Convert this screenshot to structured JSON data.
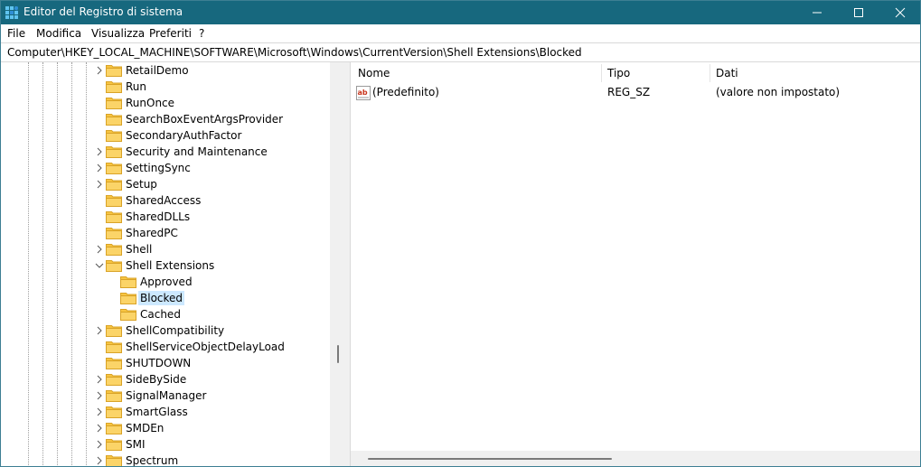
{
  "window": {
    "title": "Editor del Registro di sistema",
    "app_icon": "registry-editor-icon",
    "buttons": [
      "minimize-icon",
      "maximize-icon",
      "close-icon"
    ],
    "titlebar_color": "#17687e"
  },
  "menu": {
    "items": [
      "File",
      "Modifica",
      "Visualizza",
      "Preferiti",
      "?"
    ]
  },
  "address": {
    "path": "Computer\\HKEY_LOCAL_MACHINE\\SOFTWARE\\Microsoft\\Windows\\CurrentVersion\\Shell Extensions\\Blocked"
  },
  "tree": {
    "items": [
      {
        "label": "RetailDemo",
        "expandable": true,
        "expanded": false,
        "level": 0
      },
      {
        "label": "Run",
        "expandable": false,
        "expanded": false,
        "level": 0
      },
      {
        "label": "RunOnce",
        "expandable": false,
        "expanded": false,
        "level": 0
      },
      {
        "label": "SearchBoxEventArgsProvider",
        "expandable": false,
        "expanded": false,
        "level": 0
      },
      {
        "label": "SecondaryAuthFactor",
        "expandable": false,
        "expanded": false,
        "level": 0
      },
      {
        "label": "Security and Maintenance",
        "expandable": true,
        "expanded": false,
        "level": 0
      },
      {
        "label": "SettingSync",
        "expandable": true,
        "expanded": false,
        "level": 0
      },
      {
        "label": "Setup",
        "expandable": true,
        "expanded": false,
        "level": 0
      },
      {
        "label": "SharedAccess",
        "expandable": false,
        "expanded": false,
        "level": 0
      },
      {
        "label": "SharedDLLs",
        "expandable": false,
        "expanded": false,
        "level": 0
      },
      {
        "label": "SharedPC",
        "expandable": false,
        "expanded": false,
        "level": 0
      },
      {
        "label": "Shell",
        "expandable": true,
        "expanded": false,
        "level": 0
      },
      {
        "label": "Shell Extensions",
        "expandable": true,
        "expanded": true,
        "level": 0
      },
      {
        "label": "Approved",
        "expandable": false,
        "expanded": false,
        "level": 1
      },
      {
        "label": "Blocked",
        "expandable": false,
        "expanded": false,
        "level": 1,
        "selected": true
      },
      {
        "label": "Cached",
        "expandable": false,
        "expanded": false,
        "level": 1
      },
      {
        "label": "ShellCompatibility",
        "expandable": true,
        "expanded": false,
        "level": 0
      },
      {
        "label": "ShellServiceObjectDelayLoad",
        "expandable": false,
        "expanded": false,
        "level": 0
      },
      {
        "label": "SHUTDOWN",
        "expandable": false,
        "expanded": false,
        "level": 0
      },
      {
        "label": "SideBySide",
        "expandable": true,
        "expanded": false,
        "level": 0
      },
      {
        "label": "SignalManager",
        "expandable": true,
        "expanded": false,
        "level": 0
      },
      {
        "label": "SmartGlass",
        "expandable": true,
        "expanded": false,
        "level": 0
      },
      {
        "label": "SMDEn",
        "expandable": true,
        "expanded": false,
        "level": 0
      },
      {
        "label": "SMI",
        "expandable": true,
        "expanded": false,
        "level": 0
      },
      {
        "label": "Spectrum",
        "expandable": true,
        "expanded": false,
        "level": 0
      }
    ]
  },
  "list": {
    "columns": [
      "Nome",
      "Tipo",
      "Dati"
    ],
    "rows": [
      {
        "icon": "string-value-icon",
        "name": "(Predefinito)",
        "type": "REG_SZ",
        "data": "(valore non impostato)"
      }
    ]
  },
  "colors": {
    "selection": "#cce8ff",
    "folder": "#f8c542"
  }
}
